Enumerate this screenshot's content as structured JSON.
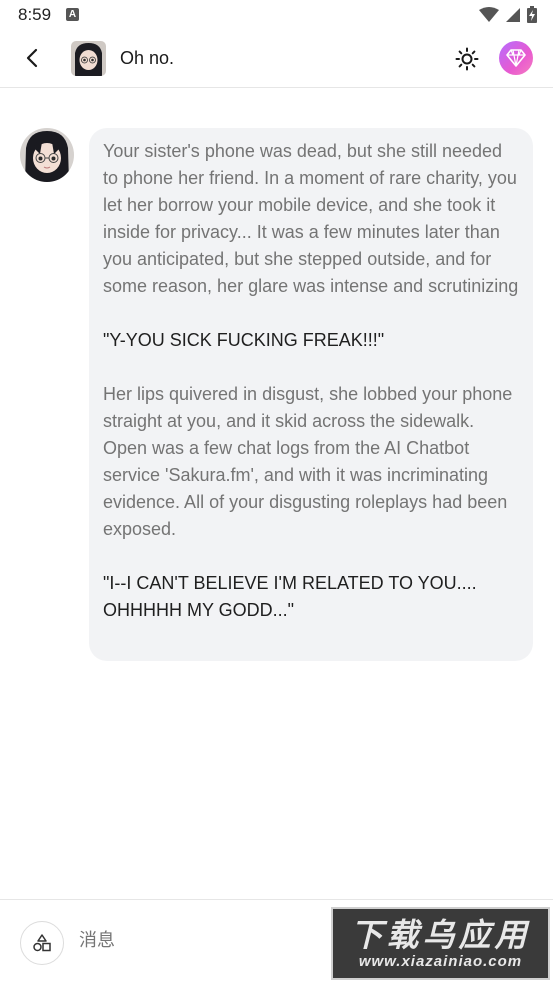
{
  "status_bar": {
    "time": "8:59",
    "notification_icon": "A"
  },
  "header": {
    "title": "Oh no.",
    "back_icon": "chevron-left-icon",
    "theme_icon": "sun-icon",
    "premium_icon": "diamond-icon",
    "premium_gradient": [
      "#b56dff",
      "#f57dc0"
    ]
  },
  "message": {
    "paragraphs": [
      {
        "text": "Your sister's phone was dead, but she still needed to phone her friend. In a moment of rare charity, you let her borrow your mobile device, and she took it inside for privacy... It was a few minutes later than you anticipated, but she stepped outside, and for some reason, her glare was intense and scrutinizing",
        "style": "narration"
      },
      {
        "text": "\"Y-YOU SICK FUCKING FREAK!!!\"",
        "style": "dialogue"
      },
      {
        "text": "Her lips quivered in disgust, she lobbed your phone straight at you, and it skid across the sidewalk. Open was a few chat logs from the AI Chatbot service 'Sakura.fm', and with it was incriminating evidence. All of your disgusting roleplays had been exposed.",
        "style": "narration"
      },
      {
        "text": "\"I--I CAN'T BELIEVE I'M RELATED TO YOU.... OHHHHH MY GODD...\"",
        "style": "dialogue"
      }
    ]
  },
  "composer": {
    "placeholder": "消息",
    "shapes_icon": "shapes-icon"
  },
  "watermark": {
    "main": "下载乌应用",
    "url": "www.xiazainiao.com"
  }
}
